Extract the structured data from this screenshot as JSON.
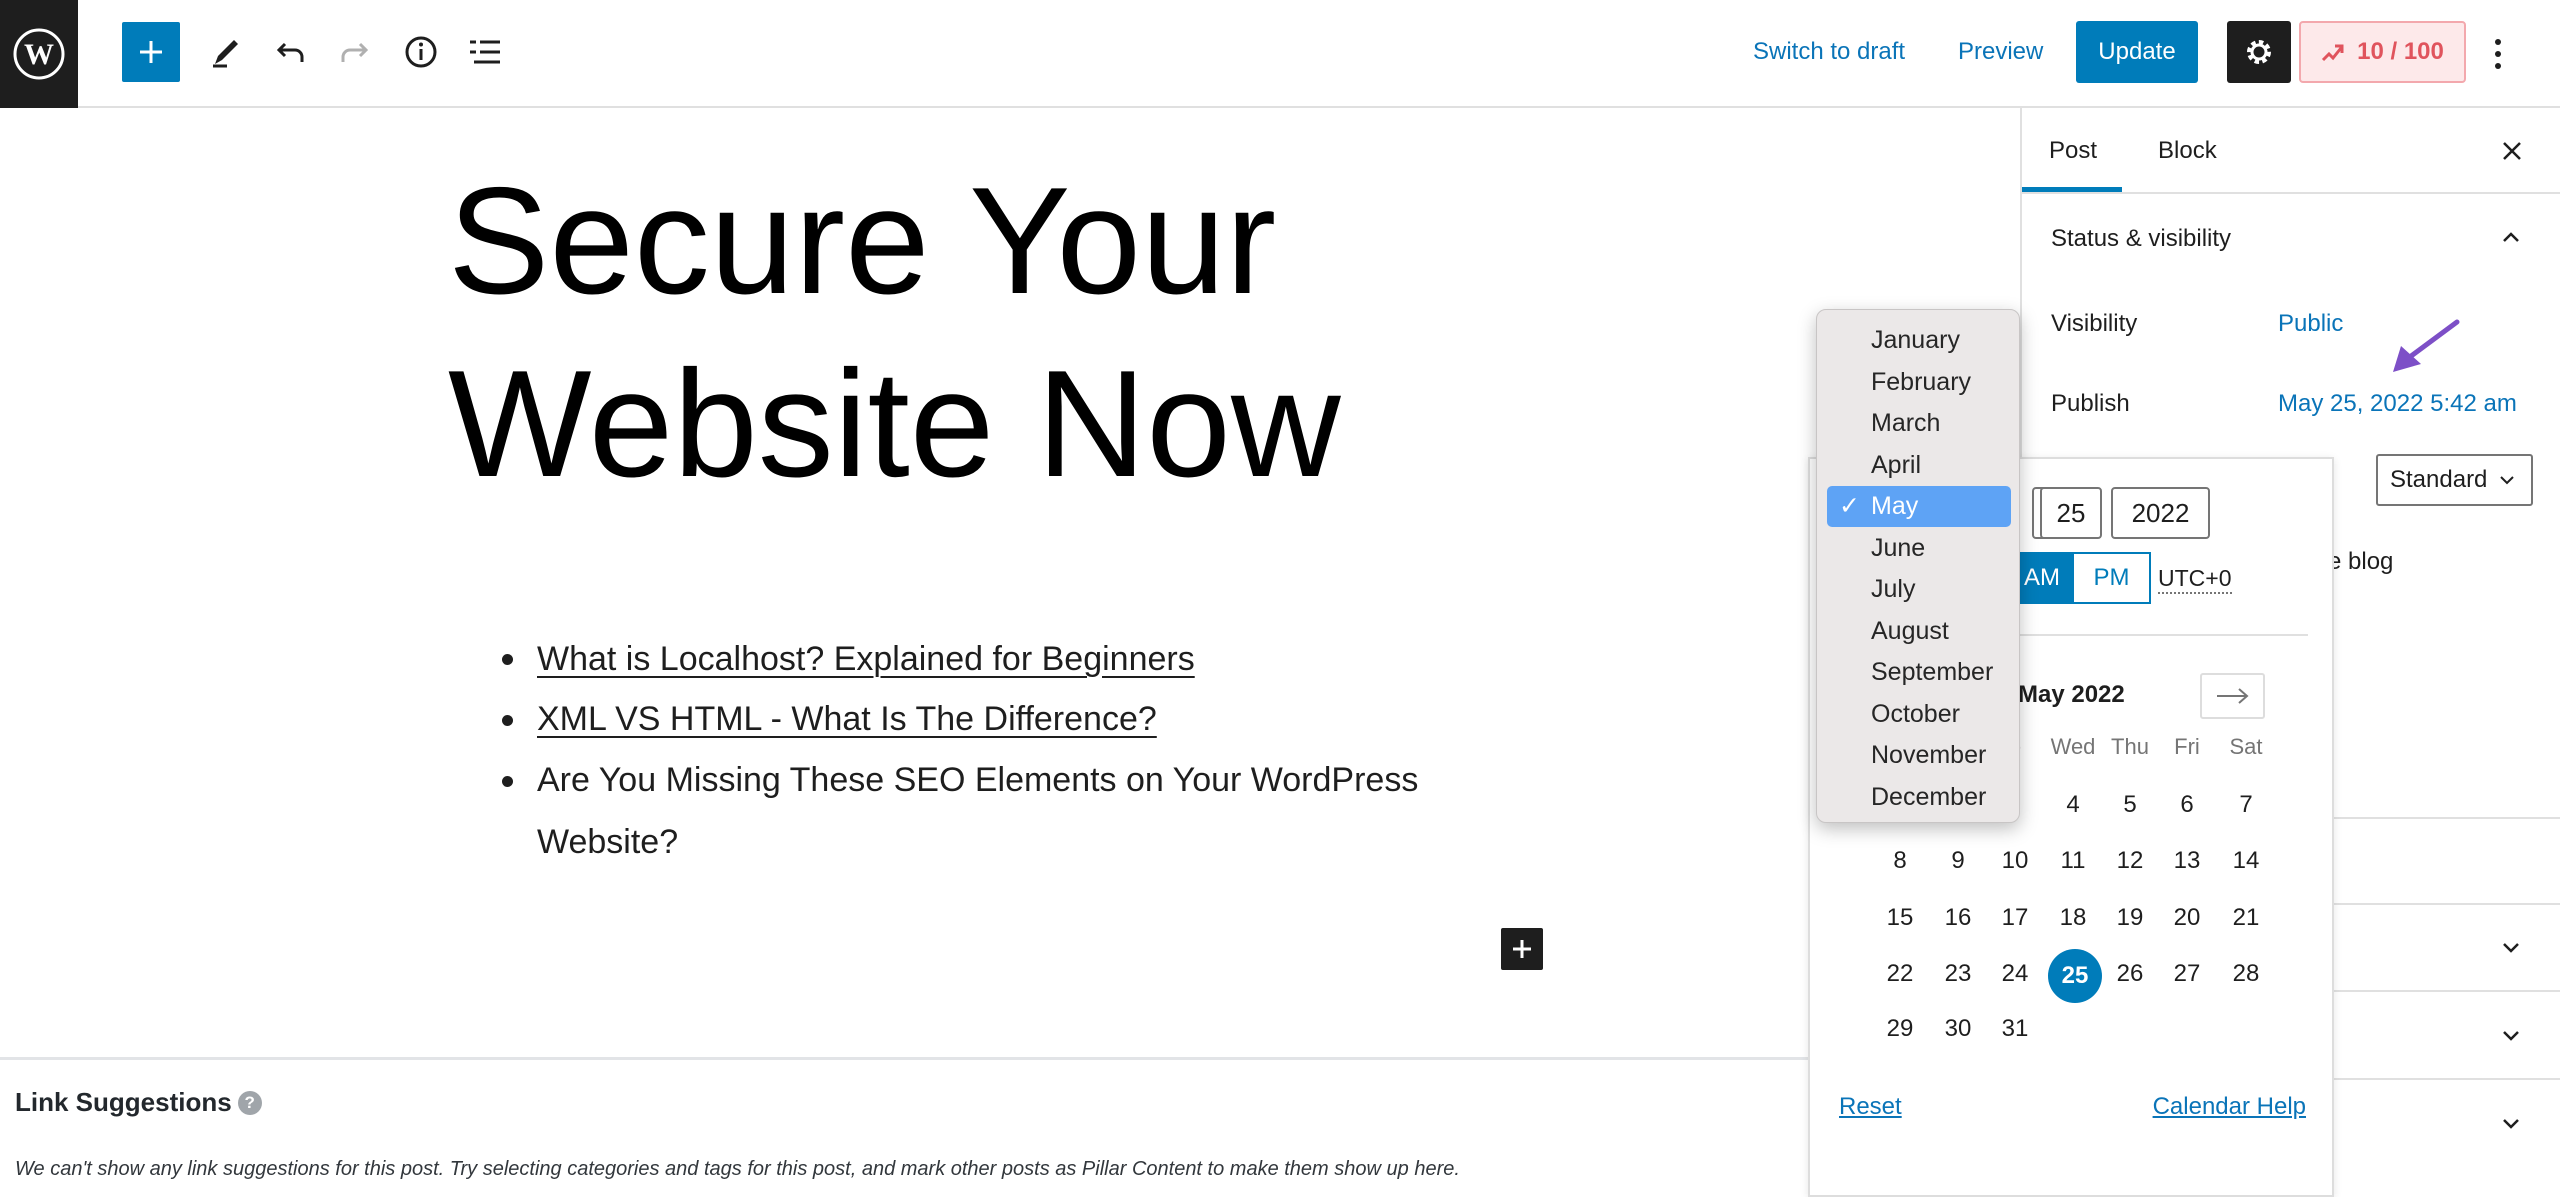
{
  "toolbar": {
    "switch_to_draft": "Switch to draft",
    "preview": "Preview",
    "update": "Update",
    "seo_score": "10 / 100"
  },
  "editor": {
    "title_lines": [
      "Secure Your",
      "Website Now"
    ],
    "list": [
      {
        "text": "What is Localhost? Explained for Beginners",
        "link": true
      },
      {
        "text": "XML VS HTML - What Is The Difference?",
        "link": true
      },
      {
        "text": "Are You Missing These SEO Elements on Your WordPress",
        "link": false
      },
      {
        "text": "Website?",
        "link": false
      }
    ]
  },
  "link_suggestions": {
    "title": "Link Suggestions",
    "message": "We can't show any link suggestions for this post. Try selecting categories and tags for this post, and mark other posts as Pillar Content to make them show up here."
  },
  "sidebar": {
    "tabs": [
      {
        "label": "Post",
        "active": true
      },
      {
        "label": "Block",
        "active": false
      }
    ],
    "panel_title": "Status & visibility",
    "visibility_label": "Visibility",
    "visibility_value": "Public",
    "publish_label": "Publish",
    "publish_value": "May 25, 2022 5:42 am",
    "format_value": "Standard",
    "sticky_partial": "e blog"
  },
  "datepicker": {
    "day": "25",
    "year": "2022",
    "am": "AM",
    "pm": "PM",
    "timezone": "UTC+0",
    "month_label": "May 2022",
    "weekdays": [
      "e",
      "Wed",
      "Thu",
      "Fri",
      "Sat"
    ],
    "weeks": [
      [
        "",
        "",
        "",
        "4",
        "5",
        "6",
        "7"
      ],
      [
        "8",
        "9",
        "10",
        "11",
        "12",
        "13",
        "14"
      ],
      [
        "15",
        "16",
        "17",
        "18",
        "19",
        "20",
        "21"
      ],
      [
        "22",
        "23",
        "24",
        "25",
        "26",
        "27",
        "28"
      ],
      [
        "29",
        "30",
        "31",
        "",
        "",
        "",
        ""
      ]
    ],
    "selected_day": "25",
    "reset": "Reset",
    "help": "Calendar Help"
  },
  "month_menu": {
    "options": [
      "January",
      "February",
      "March",
      "April",
      "May",
      "June",
      "July",
      "August",
      "September",
      "October",
      "November",
      "December"
    ],
    "selected": "May",
    "check": "✓"
  },
  "colors": {
    "accent": "#007cba",
    "dark": "#1e1e1e",
    "annotation_arrow": "#7d4fc7",
    "menu_selected": "#5ea3f5"
  }
}
